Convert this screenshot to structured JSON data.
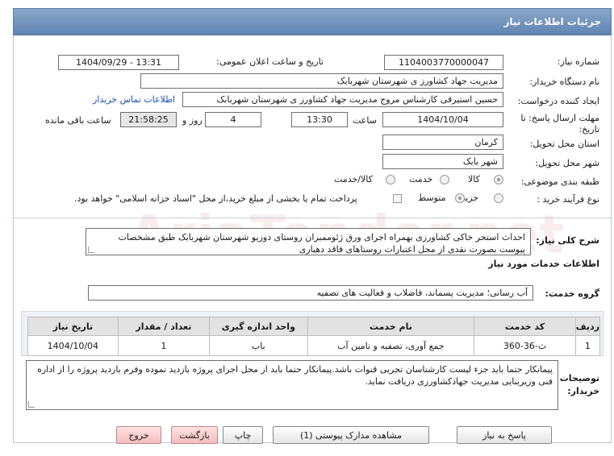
{
  "header": {
    "title": "جزئیات اطلاعات نیاز"
  },
  "fields": {
    "need_number_label": "شماره نیاز:",
    "need_number": "1104003770000047",
    "announce_label": "تاریخ و ساعت اعلان عمومی:",
    "announce_value": "1404/09/29 - 13:31",
    "buyer_org_label": "نام دستگاه خریدار:",
    "buyer_org": "مدیریت جهاد کشاورز ی شهرستان شهربابک",
    "creator_label": "ایجاد کننده درخواست:",
    "creator": "حسین استیرقی کارشناس مروج مدیریت جهاد کشاورز ی شهرستان شهربابک",
    "contact_link": "اطلاعات تماس خریدار",
    "deadline_label": "مهلت ارسال پاسخ: تا تاریخ:",
    "deadline_date": "1404/10/04",
    "time_label": "ساعت",
    "deadline_time": "13:30",
    "days_value": "4",
    "days_label": "روز و",
    "remaining_time": "21:58:25",
    "remaining_label": "ساعت باقی مانده",
    "province_label": "استان محل تحویل:",
    "province": "کرمان",
    "city_label": "شهر محل تحویل:",
    "city": "شهر بابک",
    "category_label": "طبقه بندی موضوعی:",
    "category_options": [
      "کالا",
      "خدمت",
      "کالا/خدمت"
    ],
    "process_label": "نوع فرآیند خرید :",
    "process_options": [
      "جزیی",
      "متوسط"
    ],
    "payment_note": "پرداخت تمام یا بخشی از مبلغ خرید،از محل \"اسناد خزانه اسلامی\" خواهد بود."
  },
  "description": {
    "label": "شرح کلی نیاز:",
    "text": "احداث استخر خاکی کشاورزی بهمراه اجرای ورق ژئوممبران روستای دوزیو شهرستان شهربابک طبق مشخصات پیوست بصورت نقدی از محل اعتبارات روستاهای فاقد دهیاری"
  },
  "services": {
    "section_title": "اطلاعات خدمات مورد نیاز",
    "group_label": "گروه خدمت:",
    "group_value": "آب رسانی؛ مدیریت پسماند، فاضلاب و فعالیت های تصفیه",
    "columns": [
      "ردیف",
      "کد خدمت",
      "نام خدمت",
      "واحد اندازه گیری",
      "تعداد / مقدار",
      "تاریخ نیاز"
    ],
    "rows": [
      {
        "row": "1",
        "code": "ث-36-360",
        "name": "جمع آوری، تصفیه و تامین آب",
        "unit": "باب",
        "qty": "1",
        "date": "1404/10/04"
      }
    ]
  },
  "buyer_notes": {
    "label": "توضیحات خریدار:",
    "text": "پیمانکار حتما باید جزء لیست کارشناسان تجربی قنوات باشد.پیمانکار حتما باید از محل اجرای پروژه بازدید نموده وفرم بازدید پروژه را از اداره فنی وزیربنایی مدیریت جهادکشاورزی دریافت نماید."
  },
  "buttons": {
    "reply": "پاسخ به نیاز",
    "attachments": "مشاهده مدارک پیوستی (1)",
    "print": "چاپ",
    "back": "بازگشت",
    "exit": "خروج"
  },
  "watermark": "AriaTender.net"
}
